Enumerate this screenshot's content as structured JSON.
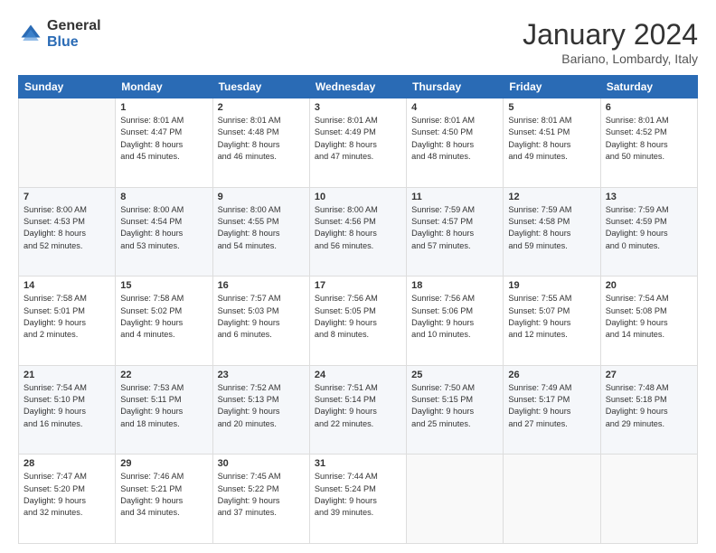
{
  "header": {
    "logo_general": "General",
    "logo_blue": "Blue",
    "month_title": "January 2024",
    "subtitle": "Bariano, Lombardy, Italy"
  },
  "weekdays": [
    "Sunday",
    "Monday",
    "Tuesday",
    "Wednesday",
    "Thursday",
    "Friday",
    "Saturday"
  ],
  "weeks": [
    [
      {
        "day": "",
        "info": ""
      },
      {
        "day": "1",
        "info": "Sunrise: 8:01 AM\nSunset: 4:47 PM\nDaylight: 8 hours\nand 45 minutes."
      },
      {
        "day": "2",
        "info": "Sunrise: 8:01 AM\nSunset: 4:48 PM\nDaylight: 8 hours\nand 46 minutes."
      },
      {
        "day": "3",
        "info": "Sunrise: 8:01 AM\nSunset: 4:49 PM\nDaylight: 8 hours\nand 47 minutes."
      },
      {
        "day": "4",
        "info": "Sunrise: 8:01 AM\nSunset: 4:50 PM\nDaylight: 8 hours\nand 48 minutes."
      },
      {
        "day": "5",
        "info": "Sunrise: 8:01 AM\nSunset: 4:51 PM\nDaylight: 8 hours\nand 49 minutes."
      },
      {
        "day": "6",
        "info": "Sunrise: 8:01 AM\nSunset: 4:52 PM\nDaylight: 8 hours\nand 50 minutes."
      }
    ],
    [
      {
        "day": "7",
        "info": "Sunrise: 8:00 AM\nSunset: 4:53 PM\nDaylight: 8 hours\nand 52 minutes."
      },
      {
        "day": "8",
        "info": "Sunrise: 8:00 AM\nSunset: 4:54 PM\nDaylight: 8 hours\nand 53 minutes."
      },
      {
        "day": "9",
        "info": "Sunrise: 8:00 AM\nSunset: 4:55 PM\nDaylight: 8 hours\nand 54 minutes."
      },
      {
        "day": "10",
        "info": "Sunrise: 8:00 AM\nSunset: 4:56 PM\nDaylight: 8 hours\nand 56 minutes."
      },
      {
        "day": "11",
        "info": "Sunrise: 7:59 AM\nSunset: 4:57 PM\nDaylight: 8 hours\nand 57 minutes."
      },
      {
        "day": "12",
        "info": "Sunrise: 7:59 AM\nSunset: 4:58 PM\nDaylight: 8 hours\nand 59 minutes."
      },
      {
        "day": "13",
        "info": "Sunrise: 7:59 AM\nSunset: 4:59 PM\nDaylight: 9 hours\nand 0 minutes."
      }
    ],
    [
      {
        "day": "14",
        "info": "Sunrise: 7:58 AM\nSunset: 5:01 PM\nDaylight: 9 hours\nand 2 minutes."
      },
      {
        "day": "15",
        "info": "Sunrise: 7:58 AM\nSunset: 5:02 PM\nDaylight: 9 hours\nand 4 minutes."
      },
      {
        "day": "16",
        "info": "Sunrise: 7:57 AM\nSunset: 5:03 PM\nDaylight: 9 hours\nand 6 minutes."
      },
      {
        "day": "17",
        "info": "Sunrise: 7:56 AM\nSunset: 5:05 PM\nDaylight: 9 hours\nand 8 minutes."
      },
      {
        "day": "18",
        "info": "Sunrise: 7:56 AM\nSunset: 5:06 PM\nDaylight: 9 hours\nand 10 minutes."
      },
      {
        "day": "19",
        "info": "Sunrise: 7:55 AM\nSunset: 5:07 PM\nDaylight: 9 hours\nand 12 minutes."
      },
      {
        "day": "20",
        "info": "Sunrise: 7:54 AM\nSunset: 5:08 PM\nDaylight: 9 hours\nand 14 minutes."
      }
    ],
    [
      {
        "day": "21",
        "info": "Sunrise: 7:54 AM\nSunset: 5:10 PM\nDaylight: 9 hours\nand 16 minutes."
      },
      {
        "day": "22",
        "info": "Sunrise: 7:53 AM\nSunset: 5:11 PM\nDaylight: 9 hours\nand 18 minutes."
      },
      {
        "day": "23",
        "info": "Sunrise: 7:52 AM\nSunset: 5:13 PM\nDaylight: 9 hours\nand 20 minutes."
      },
      {
        "day": "24",
        "info": "Sunrise: 7:51 AM\nSunset: 5:14 PM\nDaylight: 9 hours\nand 22 minutes."
      },
      {
        "day": "25",
        "info": "Sunrise: 7:50 AM\nSunset: 5:15 PM\nDaylight: 9 hours\nand 25 minutes."
      },
      {
        "day": "26",
        "info": "Sunrise: 7:49 AM\nSunset: 5:17 PM\nDaylight: 9 hours\nand 27 minutes."
      },
      {
        "day": "27",
        "info": "Sunrise: 7:48 AM\nSunset: 5:18 PM\nDaylight: 9 hours\nand 29 minutes."
      }
    ],
    [
      {
        "day": "28",
        "info": "Sunrise: 7:47 AM\nSunset: 5:20 PM\nDaylight: 9 hours\nand 32 minutes."
      },
      {
        "day": "29",
        "info": "Sunrise: 7:46 AM\nSunset: 5:21 PM\nDaylight: 9 hours\nand 34 minutes."
      },
      {
        "day": "30",
        "info": "Sunrise: 7:45 AM\nSunset: 5:22 PM\nDaylight: 9 hours\nand 37 minutes."
      },
      {
        "day": "31",
        "info": "Sunrise: 7:44 AM\nSunset: 5:24 PM\nDaylight: 9 hours\nand 39 minutes."
      },
      {
        "day": "",
        "info": ""
      },
      {
        "day": "",
        "info": ""
      },
      {
        "day": "",
        "info": ""
      }
    ]
  ]
}
